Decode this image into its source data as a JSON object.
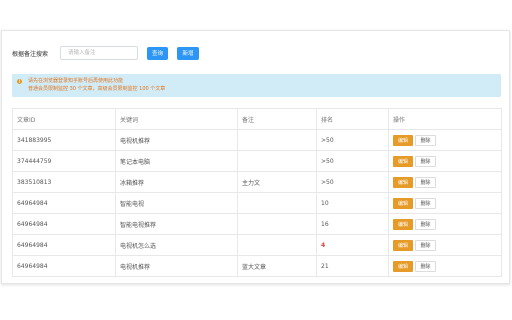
{
  "search": {
    "label": "根据备注搜索",
    "placeholder": "请输入备注",
    "value": "",
    "search_button": "查询",
    "add_button": "新增"
  },
  "notice": {
    "icon": "info-icon",
    "line1": "请先在浏览器登录知乎账号后再使用此功能",
    "line2": "普通会员限制监控 30 个文章，高级会员限制监控 100 个文章"
  },
  "table": {
    "headers": [
      "文章ID",
      "关键词",
      "备注",
      "排名",
      "操作"
    ],
    "edit_label": "编辑",
    "delete_label": "删除",
    "rows": [
      {
        "id": "341883995",
        "keyword": "电视机推荐",
        "note": "",
        "rank": ">50",
        "highlight": false
      },
      {
        "id": "374444759",
        "keyword": "笔记本电脑",
        "note": "",
        "rank": ">50",
        "highlight": false
      },
      {
        "id": "383510813",
        "keyword": "冰箱推荐",
        "note": "主力文",
        "rank": ">50",
        "highlight": false
      },
      {
        "id": "64964984",
        "keyword": "智能电视",
        "note": "",
        "rank": "10",
        "highlight": false
      },
      {
        "id": "64964984",
        "keyword": "智能电视推荐",
        "note": "",
        "rank": "16",
        "highlight": false
      },
      {
        "id": "64964984",
        "keyword": "电视机怎么选",
        "note": "",
        "rank": "4",
        "highlight": true
      },
      {
        "id": "64964984",
        "keyword": "电视机推荐",
        "note": "蓝大文章",
        "rank": "21",
        "highlight": false
      }
    ]
  },
  "colors": {
    "primary": "#2d95f3",
    "warning": "#e69a27",
    "notice_bg": "#d1ecf6",
    "notice_text": "#e17624",
    "rank_highlight": "#e03b3b"
  }
}
